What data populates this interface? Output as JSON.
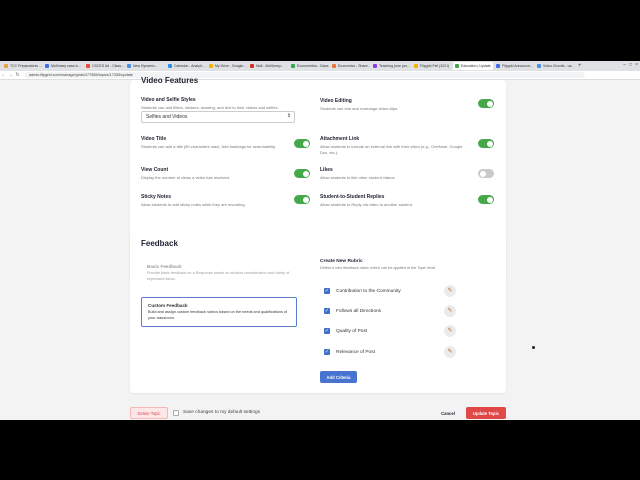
{
  "browser": {
    "tabs": [
      {
        "label": "TCC Preparatória: ...",
        "color": "#e8a33c"
      },
      {
        "label": "McKinsey case in...",
        "color": "#3c6fe8"
      },
      {
        "label": "CSCES Ad - Class...",
        "color": "#e84c3c"
      },
      {
        "label": "New Dynamic...",
        "color": "#4c8de8"
      },
      {
        "label": "Calendar - Analyti...",
        "color": "#2a8de8"
      },
      {
        "label": "My Drive - Google...",
        "color": "#f4b400"
      },
      {
        "label": "Mail - McKinsey...",
        "color": "#d93025"
      },
      {
        "label": "Econometria - Class...",
        "color": "#34a853"
      },
      {
        "label": "Economics - Share...",
        "color": "#e8733c"
      },
      {
        "label": "Teaching (one pro...",
        "color": "#8a3ce8"
      },
      {
        "label": "Flipgrid Fell (2021)",
        "color": "#f4b400"
      },
      {
        "label": "Education | Update",
        "color": "#45a84b",
        "active": true
      },
      {
        "label": "Flipgrid Announce...",
        "color": "#3c6fe8"
      },
      {
        "label": "Video Circuits - us...",
        "color": "#4c8de8"
      }
    ],
    "new_tab": "+",
    "window_controls": [
      "–",
      "□",
      "×"
    ],
    "url": "admin.flipgrid.com/manage/grids/477585/topics/17335/update",
    "nav": {
      "back": "←",
      "forward": "→",
      "reload": "↻"
    }
  },
  "video_features": {
    "title": "Video Features",
    "settings": [
      {
        "title": "Video and Selfie Styles",
        "desc": "Students can add filters, stickers, drawing, and text to their videos and selfies."
      },
      {
        "title": "Video Editing",
        "desc": "Students can trim and rearrange video clips."
      },
      {
        "title": "Video Title",
        "desc": "Students can add a title (80 characters max). Add hashtags for searchability."
      },
      {
        "title": "Attachment Link",
        "desc": "Allow students to include an external link with their video (e.g., OneNote, Google Doc, etc.)."
      },
      {
        "title": "View Count",
        "desc": "Display the number of views a video has received."
      },
      {
        "title": "Likes",
        "desc": "Allow students to like other student videos."
      },
      {
        "title": "Sticky Notes",
        "desc": "Allow students to add sticky notes while they are recording."
      },
      {
        "title": "Student-to-Student Replies",
        "desc": "Allow students to Reply via video to another student."
      }
    ],
    "toggles": {
      "video_editing": true,
      "video_title": true,
      "attachment_link": true,
      "view_count": true,
      "likes": false,
      "sticky_notes": true,
      "student_replies": true
    },
    "styles_select": {
      "value": "Selfies and Videos",
      "arrow": "⇕"
    }
  },
  "feedback": {
    "title": "Feedback",
    "options": [
      {
        "title": "Basic Feedback",
        "desc": "Provide basic feedback on a Response based on student consideration and clarity of expressed ideas.",
        "selected": false
      },
      {
        "title": "Custom Feedback",
        "desc": "Build and assign custom feedback rubrics based on the needs and qualifications of your classroom.",
        "selected": true
      }
    ],
    "rubric": {
      "title": "Create New Rubric",
      "subtitle": "Define a new feedback rubric which can be applied at the Topic level.",
      "criteria": [
        {
          "label": "Contribution to the Community",
          "checked": true
        },
        {
          "label": "Follows all Directions",
          "checked": true
        },
        {
          "label": "Quality of Post",
          "checked": true
        },
        {
          "label": "Relevance of Post",
          "checked": true
        }
      ],
      "check_glyph": "✓",
      "edit_glyph": "✎",
      "add_label": "Add Criteria"
    }
  },
  "footer": {
    "delete_label": "Delete Topic",
    "save_default_label": "Save changes to my default settings",
    "cancel_label": "Cancel",
    "update_label": "Update Topic"
  },
  "colors": {
    "toggle_on": "#45a84b",
    "primary": "#4774cf",
    "danger": "#e04848",
    "delete_bg": "#fde7e7"
  }
}
